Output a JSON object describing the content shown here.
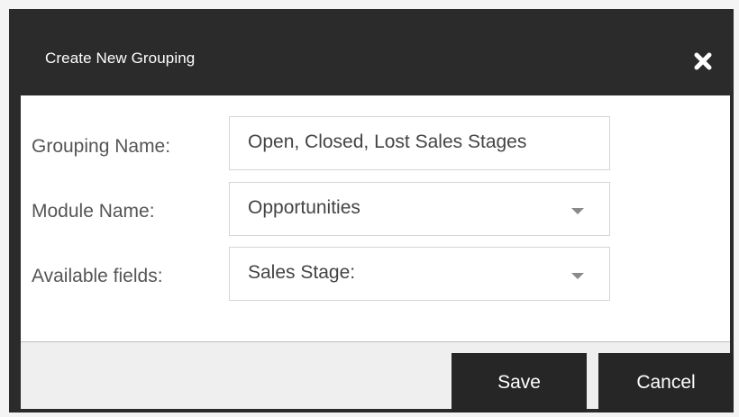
{
  "dialog": {
    "title": "Create New Grouping",
    "close_icon": "close-icon"
  },
  "form": {
    "grouping_name": {
      "label": "Grouping Name:",
      "value": "Open, Closed, Lost Sales Stages"
    },
    "module_name": {
      "label": "Module Name:",
      "value": "Opportunities",
      "icon": "chevron-down-icon"
    },
    "available_fields": {
      "label": "Available fields:",
      "value": "Sales Stage:",
      "icon": "chevron-down-icon"
    }
  },
  "footer": {
    "save_label": "Save",
    "cancel_label": "Cancel"
  },
  "colors": {
    "header_bg": "#2b2b2b",
    "button_bg": "#262626",
    "body_bg": "#ffffff",
    "footer_bg": "#efefef"
  }
}
